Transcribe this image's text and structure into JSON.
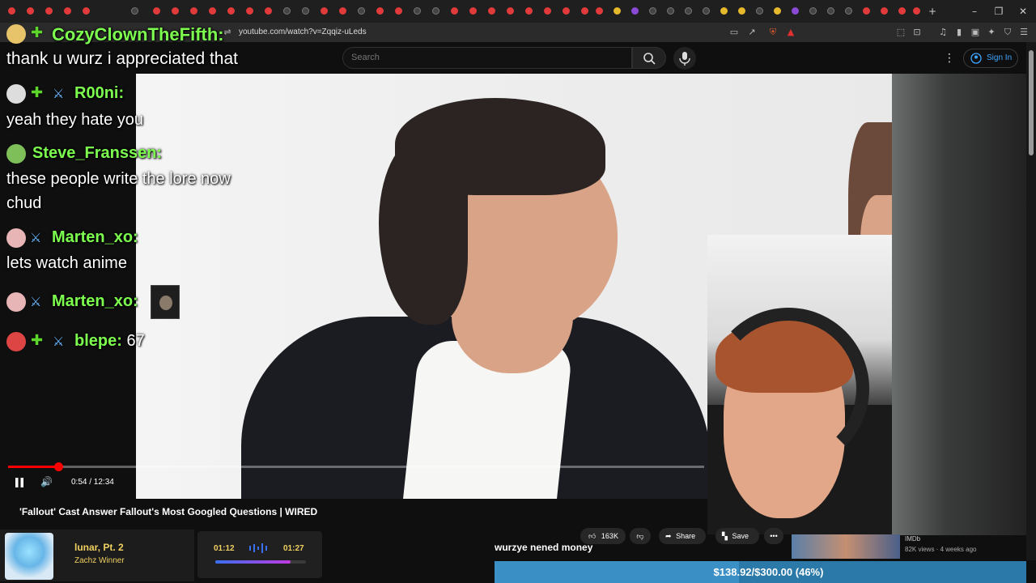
{
  "browser": {
    "url": "youtube.com/watch?v=Zqqiz-uLeds"
  },
  "youtube": {
    "search_placeholder": "Search",
    "signin_label": "Sign In"
  },
  "player": {
    "time_display": "0:54 / 12:34",
    "progress_fraction": 0.072,
    "title": "'Fallout' Cast Answer Fallout's Most Googled Questions | WIRED",
    "channel": "WIRED",
    "likes": "163K",
    "share_label": "Share",
    "save_label": "Save"
  },
  "chat": [
    {
      "user": "CozyClownTheFifth:",
      "message": "",
      "badges": [
        "gem"
      ]
    },
    {
      "user": "",
      "message": "thank u wurz i appreciated that",
      "badges": []
    },
    {
      "user": "R00ni:",
      "message": "",
      "badges": [
        "gem",
        "sword"
      ]
    },
    {
      "user": "",
      "message": "yeah they hate you",
      "badges": []
    },
    {
      "user": "Steve_Franssen:",
      "message": "",
      "badges": []
    },
    {
      "user": "",
      "message": "these people write the lore now",
      "badges": []
    },
    {
      "user": "",
      "message": "chud",
      "badges": []
    },
    {
      "user": "Marten_xo:",
      "message": "",
      "badges": [
        "sword"
      ]
    },
    {
      "user": "",
      "message": "lets watch anime",
      "badges": []
    },
    {
      "user": "Marten_xo:",
      "message": "",
      "badges": [
        "sword"
      ]
    },
    {
      "user": "blepe:",
      "message": "67",
      "badges": [
        "gem",
        "sword"
      ]
    }
  ],
  "music": {
    "title": "lunar, Pt. 2",
    "artist": "Zachz Winner",
    "elapsed": "01:12",
    "total": "01:27",
    "progress_fraction": 0.83
  },
  "stream": {
    "tts_text": "wurzye nened money",
    "donation_text": "$138.92/$300.00 (46%)",
    "donation_fraction": 0.46
  },
  "recommendation": {
    "channel": "IMDb",
    "meta": "82K views · 4 weeks ago"
  },
  "colors": {
    "accent_red": "#ff0000",
    "chat_name": "#7dff4f",
    "music_text": "#f0d060",
    "donation": "#2b79a8"
  }
}
